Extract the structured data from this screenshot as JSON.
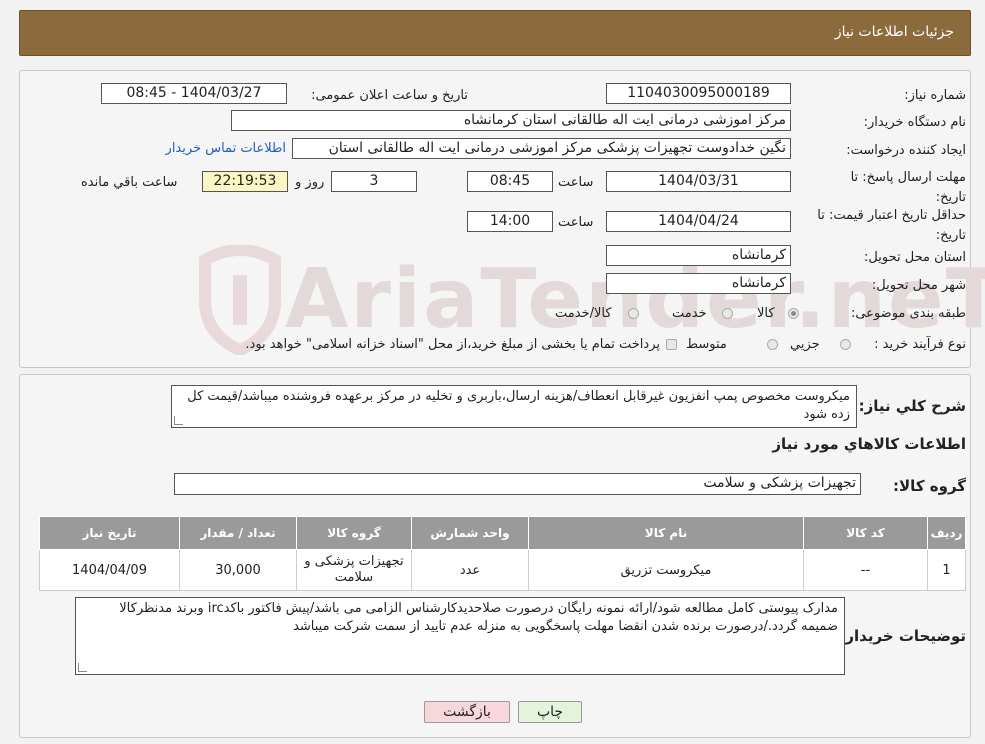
{
  "header": {
    "title": "جزئیات اطلاعات نیاز"
  },
  "watermark": "AriaTender.neT",
  "fields": {
    "need_number_label": "شماره نیاز:",
    "need_number": "1104030095000189",
    "announce_label": "تاریخ و ساعت اعلان عمومی:",
    "announce_value": "1404/03/27 - 08:45",
    "buyer_label": "نام دستگاه خریدار:",
    "buyer_value": "مرکز اموزشی درمانی ایت اله طالقانی استان کرمانشاه",
    "creator_label": "ایجاد کننده درخواست:",
    "creator_value": "نگین خدادوست تجهیزات پزشکی مرکز اموزشی درمانی ایت اله طالقانی استان",
    "contact_link": "اطلاعات تماس خریدار",
    "deadline_label": "مهلت ارسال پاسخ: تا تاریخ:",
    "deadline_date": "1404/03/31",
    "time_word": "ساعت",
    "deadline_time": "08:45",
    "days_value": "3",
    "days_word": "روز و",
    "remaining_time": "22:19:53",
    "remaining_word": "ساعت باقي مانده",
    "validity_label": "حداقل تاریخ اعتبار قیمت: تا تاریخ:",
    "validity_date": "1404/04/24",
    "validity_time": "14:00",
    "province_label": "استان محل تحویل:",
    "province_value": "کرمانشاه",
    "city_label": "شهر محل تحویل:",
    "city_value": "کرمانشاه",
    "category_label": "طبقه بندی موضوعی:",
    "category_options": [
      "کالا",
      "خدمت",
      "کالا/خدمت"
    ],
    "process_label": "نوع فرآیند خرید :",
    "process_options": [
      "جزيي",
      "متوسط"
    ],
    "process_note": "پرداخت تمام یا بخشی از مبلغ خرید،از محل \"اسناد خزانه اسلامی\" خواهد بود."
  },
  "description": {
    "label": "شرح کلي نياز:",
    "text": "میکروست مخصوص پمپ انفزیون غیرقابل انعطاف/هزینه ارسال،باربری و تخلیه در مرکز برعهده فروشنده میباشد/قیمت کل زده شود"
  },
  "goods_section_title": "اطلاعات کالاهاي مورد نياز",
  "goods_group": {
    "label": "گروه کالا:",
    "value": "تجهیزات پزشکی و سلامت"
  },
  "table": {
    "headers": [
      "رديف",
      "کد کالا",
      "نام کالا",
      "واحد شمارش",
      "گروه کالا",
      "تعداد / مقدار",
      "تاریخ نیاز"
    ],
    "rows": [
      [
        "1",
        "--",
        "میکروست تزریق",
        "عدد",
        "تجهیزات پزشکی و سلامت",
        "30,000",
        "1404/04/09"
      ]
    ]
  },
  "buyer_notes": {
    "label": "توضیحات خریدار:",
    "text": "مدارک پیوستی کامل مطالعه شود/ارائه نمونه رایگان درصورت صلاحدیدکارشناس الزامی می باشد/پیش فاکتور باکدirc وبرند مدنظرکالا ضمیمه گردد./درصورت برنده شدن انقضا مهلت پاسخگویی به منزله عدم تایید از سمت شرکت میباشد"
  },
  "buttons": {
    "print": "چاپ",
    "back": "بازگشت"
  },
  "colors": {
    "header": "#8b6a3b",
    "table_header": "#9a9a9a",
    "remaining_bg": "#fbf7c4",
    "back_button": "#f8d7dc",
    "print_button": "#e3f3dc",
    "link": "#1d5fbf"
  }
}
